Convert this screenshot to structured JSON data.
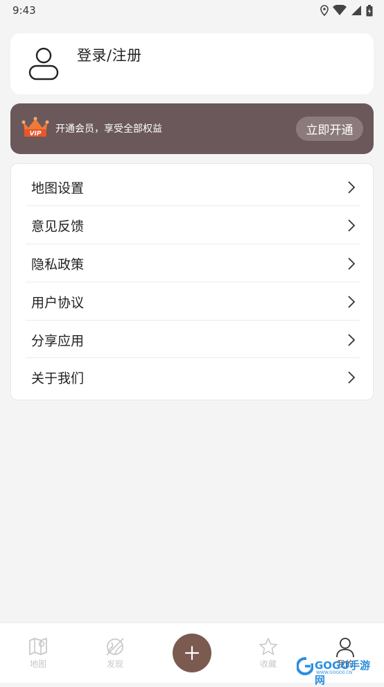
{
  "status_bar": {
    "time": "9:43"
  },
  "login": {
    "label": "登录/注册"
  },
  "vip": {
    "text": "开通会员，享受全部权益",
    "button_label": "立即开通",
    "badge": "VIP"
  },
  "menu": {
    "items": [
      {
        "label": "地图设置"
      },
      {
        "label": "意见反馈"
      },
      {
        "label": "隐私政策"
      },
      {
        "label": "用户协议"
      },
      {
        "label": "分享应用"
      },
      {
        "label": "关于我们"
      }
    ]
  },
  "tab_bar": {
    "tabs": [
      {
        "label": "地图",
        "icon": "map-icon"
      },
      {
        "label": "发现",
        "icon": "compass-icon"
      },
      {
        "label": "收藏",
        "icon": "star-icon"
      },
      {
        "label": "我的",
        "icon": "person-icon"
      }
    ],
    "add_icon": "plus-icon"
  },
  "watermark": {
    "brand": "GOGO手游网",
    "url": "WWW.GOGO0.CN"
  },
  "colors": {
    "vip_banner": "#6b585b",
    "vip_button": "#8c7b7d",
    "add_button": "#7b5a50",
    "background": "#f4f4f4"
  }
}
